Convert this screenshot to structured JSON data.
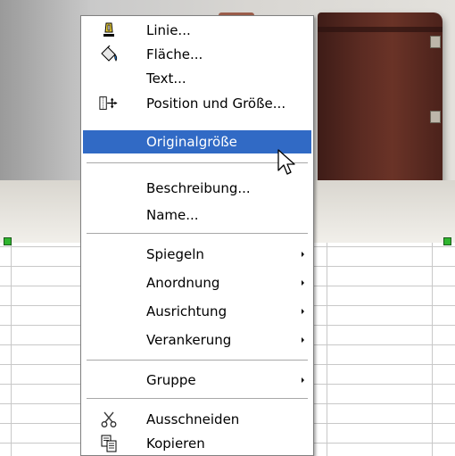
{
  "menu": {
    "items": [
      {
        "label": "Linie...",
        "icon": "line-pen-icon"
      },
      {
        "label": "Fläche...",
        "icon": "fill-bucket-icon"
      },
      {
        "label": "Text...",
        "icon": ""
      },
      {
        "label": "Position und Größe...",
        "icon": "position-size-icon"
      },
      {
        "label": "Originalgröße",
        "icon": "",
        "highlighted": true
      },
      {
        "label": "Beschreibung...",
        "icon": ""
      },
      {
        "label": "Name...",
        "icon": ""
      },
      {
        "label": "Spiegeln",
        "submenu": true
      },
      {
        "label": "Anordnung",
        "submenu": true
      },
      {
        "label": "Ausrichtung",
        "submenu": true
      },
      {
        "label": "Verankerung",
        "submenu": true
      },
      {
        "label": "Gruppe",
        "submenu": true
      },
      {
        "label": "Ausschneiden",
        "icon": "scissors-icon"
      },
      {
        "label": "Kopieren",
        "icon": "copy-icon"
      }
    ],
    "highlight_color": "#316ac5"
  },
  "selection_handle_color": "#2fb52f"
}
